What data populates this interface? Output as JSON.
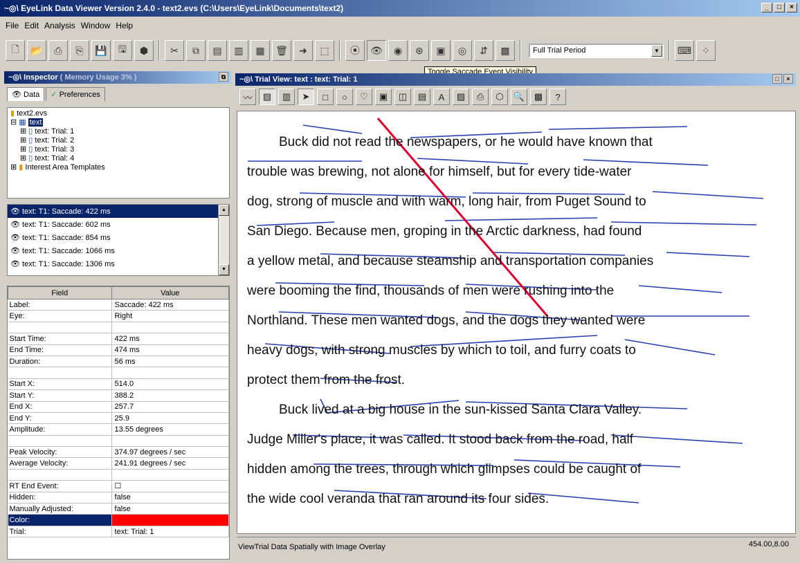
{
  "window": {
    "title": "EyeLink Data Viewer Version 2.4.0 - text2.evs (C:\\Users\\EyeLink\\Documents\\text2)",
    "buttons": [
      "_",
      "□",
      "×"
    ]
  },
  "menu": [
    "File",
    "Edit",
    "Analysis",
    "Window",
    "Help"
  ],
  "toolbar": {
    "period_select": "Full Trial Period",
    "tooltip": "Toggle Saccade Event Visibility"
  },
  "inspector": {
    "title": "Inspector",
    "memory": "( Memory Usage 3% )",
    "tabs": [
      "Data",
      "Preferences"
    ],
    "tree": {
      "root": "text2.evs",
      "group": "text",
      "trials": [
        "text: Trial: 1",
        "text: Trial: 2",
        "text: Trial: 3",
        "text: Trial: 4"
      ],
      "templates": "Interest Area Templates"
    },
    "events": [
      "text: T1: Saccade: 422 ms",
      "text: T1: Saccade: 602 ms",
      "text: T1: Saccade: 854 ms",
      "text: T1: Saccade: 1066 ms",
      "text: T1: Saccade: 1306 ms"
    ],
    "props_header": [
      "Field",
      "Value"
    ],
    "props": [
      [
        "Label:",
        "Saccade: 422 ms"
      ],
      [
        "Eye:",
        "Right"
      ],
      [
        "",
        ""
      ],
      [
        "Start Time:",
        "422 ms"
      ],
      [
        "End Time:",
        "474 ms"
      ],
      [
        "Duration:",
        "56 ms"
      ],
      [
        "",
        ""
      ],
      [
        "Start X:",
        "514.0"
      ],
      [
        "Start Y:",
        "388.2"
      ],
      [
        "End X:",
        "257.7"
      ],
      [
        "End Y:",
        "25.9"
      ],
      [
        "Amplitude:",
        "13.55 degrees"
      ],
      [
        "",
        ""
      ],
      [
        "Peak Velocity:",
        "374.97 degrees / sec"
      ],
      [
        "Average Velocity:",
        "241.91 degrees / sec"
      ],
      [
        "",
        ""
      ],
      [
        "RT End Event:",
        "☐"
      ],
      [
        "Hidden:",
        "false"
      ],
      [
        "Manually Adjusted:",
        "false"
      ],
      [
        "Color:",
        ""
      ],
      [
        "Trial:",
        "text: Trial: 1"
      ]
    ],
    "color_value": "#ff0000"
  },
  "trial_view": {
    "title": "Trial View: text : text: Trial: 1",
    "lines": [
      "Buck did not read the newspapers, or he would have known that",
      "trouble was brewing, not alone for himself, but for every tide-water",
      "dog, strong of muscle and with warm, long hair, from Puget Sound to",
      "San Diego.  Because men, groping in the Arctic darkness, had found",
      "a yellow metal, and because steamship and transportation companies",
      "were booming the find, thousands of men were rushing into the",
      "Northland.  These men wanted dogs, and the dogs they wanted were",
      "heavy dogs, with strong muscles by which to toil, and furry coats to",
      "protect them from the frost.",
      "Buck lived at a big house in the sun-kissed Santa Clara Valley.",
      "Judge Miller's place, it was called.  It stood back from the road, half",
      "hidden among the trees, through which glimpses could be caught of",
      "the wide cool veranda that ran around its four sides."
    ],
    "status_text": "ViewTrial Data Spatially with Image Overlay",
    "coords": "454.00,8.00"
  }
}
